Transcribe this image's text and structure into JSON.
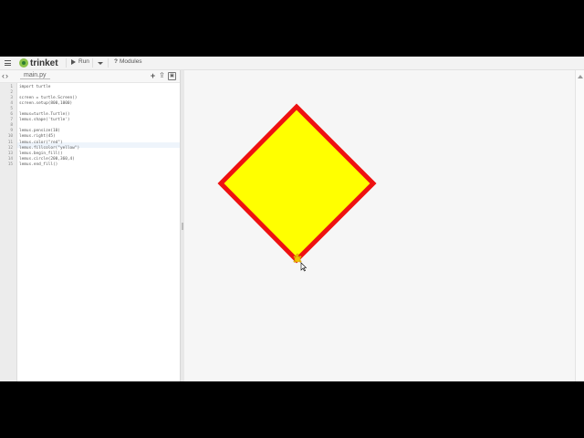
{
  "toolbar": {
    "menu_icon": "hamburger-menu-icon",
    "logo_text": "trinket",
    "run_label": "Run",
    "modules_label": "Modules"
  },
  "file": {
    "tab_name": "main.py"
  },
  "editor": {
    "active_line": 10,
    "lines": [
      {
        "n": "1",
        "text": "import turtle"
      },
      {
        "n": "2",
        "text": ""
      },
      {
        "n": "3",
        "text": "screen = turtle.Screen()"
      },
      {
        "n": "4",
        "text": "screen.setup(800,1000)"
      },
      {
        "n": "5",
        "text": ""
      },
      {
        "n": "6",
        "text": "lemus=turtle.Turtle()"
      },
      {
        "n": "7",
        "text": "lemus.shape('turtle')"
      },
      {
        "n": "8",
        "text": ""
      },
      {
        "n": "9",
        "text": "lemus.pensize(10)"
      },
      {
        "n": "10",
        "text": "lemus.right(45)"
      },
      {
        "n": "11",
        "text": "lemus.color(\"red\")"
      },
      {
        "n": "12",
        "text": "lemus.fillcolor(\"yellow\")"
      },
      {
        "n": "13",
        "text": "lemus.begin_fill()"
      },
      {
        "n": "14",
        "text": "lemus.circle(200,360,4)"
      },
      {
        "n": "15",
        "text": "lemus.end_fill()"
      }
    ]
  },
  "output": {
    "shape_fill": "#ffff00",
    "shape_stroke": "#ee1111",
    "turtle_color": "#f2c200"
  },
  "colors": {
    "toolbar_bg": "#f3f3f3",
    "gutter_bg": "#ececec",
    "output_bg": "#f6f6f6"
  }
}
